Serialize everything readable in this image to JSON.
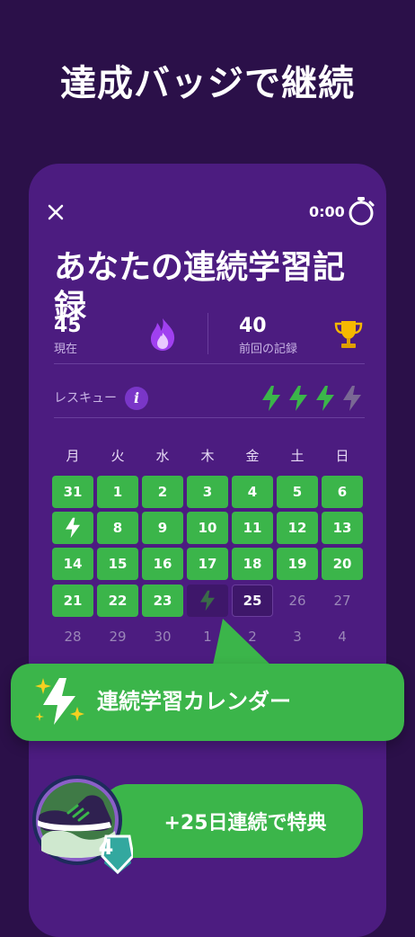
{
  "headline": "達成バッジで継続",
  "screen": {
    "timer": "0:00",
    "title": "あなたの連続学習記録",
    "current": {
      "value": "45",
      "label": "現在"
    },
    "record": {
      "value": "40",
      "label": "前回の記録"
    },
    "rescue": {
      "label": "レスキュー",
      "info_icon": "i",
      "available": 3,
      "total": 4
    }
  },
  "calendar": {
    "weekdays": [
      "月",
      "火",
      "水",
      "木",
      "金",
      "土",
      "日"
    ],
    "weeks": [
      [
        {
          "d": "31",
          "s": "done"
        },
        {
          "d": "1",
          "s": "done"
        },
        {
          "d": "2",
          "s": "done"
        },
        {
          "d": "3",
          "s": "done"
        },
        {
          "d": "4",
          "s": "done"
        },
        {
          "d": "5",
          "s": "done"
        },
        {
          "d": "6",
          "s": "done"
        }
      ],
      [
        {
          "d": "",
          "s": "rescue"
        },
        {
          "d": "8",
          "s": "done"
        },
        {
          "d": "9",
          "s": "done"
        },
        {
          "d": "10",
          "s": "done"
        },
        {
          "d": "11",
          "s": "done"
        },
        {
          "d": "12",
          "s": "done"
        },
        {
          "d": "13",
          "s": "done"
        }
      ],
      [
        {
          "d": "14",
          "s": "done"
        },
        {
          "d": "15",
          "s": "done"
        },
        {
          "d": "16",
          "s": "done"
        },
        {
          "d": "17",
          "s": "done"
        },
        {
          "d": "18",
          "s": "done"
        },
        {
          "d": "19",
          "s": "done"
        },
        {
          "d": "20",
          "s": "done"
        }
      ],
      [
        {
          "d": "21",
          "s": "done"
        },
        {
          "d": "22",
          "s": "done"
        },
        {
          "d": "23",
          "s": "done"
        },
        {
          "d": "",
          "s": "missed"
        },
        {
          "d": "25",
          "s": "today"
        },
        {
          "d": "26",
          "s": "future"
        },
        {
          "d": "27",
          "s": "future"
        }
      ],
      [
        {
          "d": "28",
          "s": "future"
        },
        {
          "d": "29",
          "s": "future"
        },
        {
          "d": "30",
          "s": "future"
        },
        {
          "d": "1",
          "s": "future"
        },
        {
          "d": "2",
          "s": "future"
        },
        {
          "d": "3",
          "s": "future"
        },
        {
          "d": "4",
          "s": "future"
        }
      ]
    ]
  },
  "banner": {
    "text": "連続学習カレンダー"
  },
  "cta": {
    "text": "+25日連続で特典",
    "badge_level": "4"
  },
  "colors": {
    "background": "#2b1049",
    "panel": "#4c1c80",
    "accent_green": "#3bb54a",
    "flame": "#a040f0",
    "trophy": "#f5b800"
  },
  "icons": [
    "close-icon",
    "stopwatch-icon",
    "flame-icon",
    "trophy-icon",
    "info-icon",
    "lightning-icon",
    "sparkle-bolt-icon",
    "sneaker-badge-icon"
  ]
}
